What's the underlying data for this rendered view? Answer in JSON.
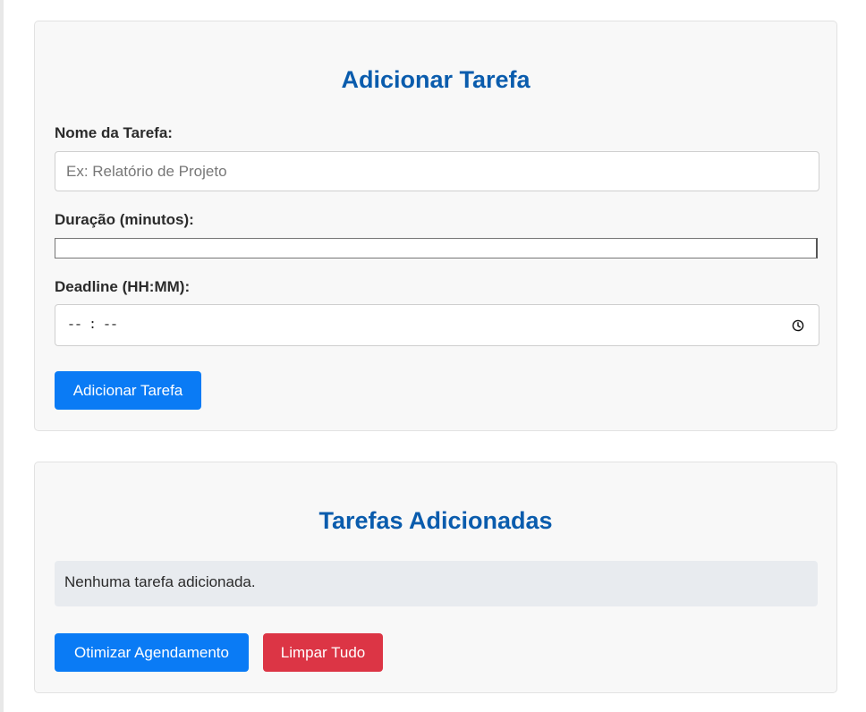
{
  "add_task": {
    "title": "Adicionar Tarefa",
    "name_label": "Nome da Tarefa:",
    "name_placeholder": "Ex: Relatório de Projeto",
    "name_value": "",
    "duration_label": "Duração (minutos):",
    "deadline_label": "Deadline (HH:MM):",
    "deadline_value": "-- : --",
    "submit_label": "Adicionar Tarefa"
  },
  "task_list": {
    "title": "Tarefas Adicionadas",
    "empty_message": "Nenhuma tarefa adicionada.",
    "optimize_label": "Otimizar Agendamento",
    "clear_label": "Limpar Tudo"
  },
  "icons": {
    "deadline_picker": "clock-icon"
  },
  "colors": {
    "heading": "#0a5cad",
    "primary": "#0a7bf5",
    "danger": "#dc3545"
  }
}
